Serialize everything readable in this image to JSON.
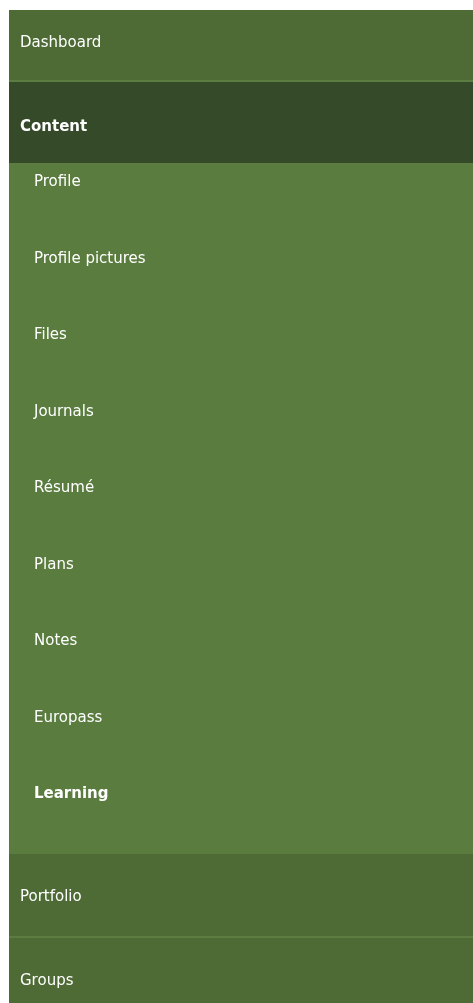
{
  "nav": {
    "items": [
      {
        "label": "Dashboard",
        "selected": false
      },
      {
        "label": "Content",
        "selected": true,
        "expanded": true,
        "children": [
          {
            "label": "Profile",
            "selected": false
          },
          {
            "label": "Profile pictures",
            "selected": false
          },
          {
            "label": "Files",
            "selected": false
          },
          {
            "label": "Journals",
            "selected": false
          },
          {
            "label": "Résumé",
            "selected": false
          },
          {
            "label": "Plans",
            "selected": false
          },
          {
            "label": "Notes",
            "selected": false
          },
          {
            "label": "Europass",
            "selected": false
          },
          {
            "label": "Learning",
            "selected": true
          }
        ]
      },
      {
        "label": "Portfolio",
        "selected": false
      },
      {
        "label": "Groups",
        "selected": false
      }
    ]
  }
}
